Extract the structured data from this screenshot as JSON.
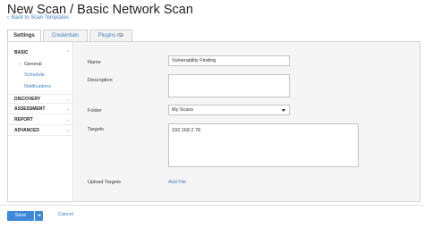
{
  "page": {
    "title": "New Scan / Basic Network Scan",
    "back_link": "Back to Scan Templates"
  },
  "tabs": [
    {
      "label": "Settings",
      "active": true
    },
    {
      "label": "Credentials",
      "active": false
    },
    {
      "label": "Plugins",
      "active": false
    }
  ],
  "sidebar": {
    "basic": "BASIC",
    "general": "General",
    "schedule": "Schedule",
    "notifications": "Notifications",
    "discovery": "DISCOVERY",
    "assessment": "ASSESSMENT",
    "report": "REPORT",
    "advanced": "ADVANCED"
  },
  "form": {
    "name_label": "Name",
    "name_value": "Vulnerability Finding",
    "description_label": "Description",
    "description_value": "",
    "folder_label": "Folder",
    "folder_value": "My Scans",
    "targets_label": "Targets",
    "targets_value": "192.168.2.78",
    "upload_label": "Upload Targets",
    "add_file": "Add File"
  },
  "footer": {
    "save": "Save",
    "cancel": "Cancel"
  },
  "colors": {
    "accent": "#3e8ad8",
    "link": "#3d7fc4"
  }
}
